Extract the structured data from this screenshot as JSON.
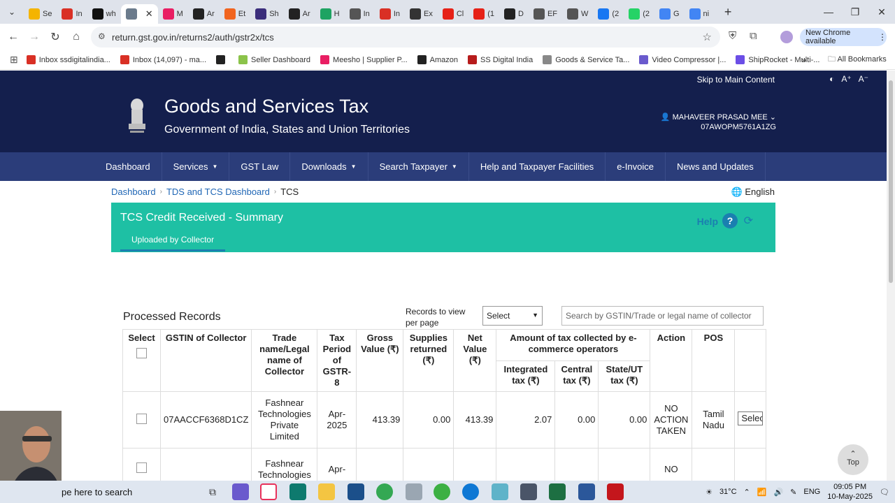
{
  "browser": {
    "tabs": [
      {
        "label": "Se",
        "color": "#f4b400"
      },
      {
        "label": "In",
        "color": "#d93025"
      },
      {
        "label": "wh",
        "color": "#111111"
      },
      {
        "label": "",
        "color": "#6b7b8c",
        "active": true
      },
      {
        "label": "M",
        "color": "#e91e63"
      },
      {
        "label": "Ar",
        "color": "#222222"
      },
      {
        "label": "Et",
        "color": "#f1641e"
      },
      {
        "label": "Sh",
        "color": "#3a2d7b"
      },
      {
        "label": "Ar",
        "color": "#222222"
      },
      {
        "label": "H",
        "color": "#1ea362"
      },
      {
        "label": "In",
        "color": "#555555"
      },
      {
        "label": "In",
        "color": "#d93025"
      },
      {
        "label": "Ex",
        "color": "#333333"
      },
      {
        "label": "Cl",
        "color": "#e62117"
      },
      {
        "label": "(1",
        "color": "#e62117"
      },
      {
        "label": "D",
        "color": "#222222"
      },
      {
        "label": "EF",
        "color": "#555555"
      },
      {
        "label": "W",
        "color": "#555555"
      },
      {
        "label": "(2",
        "color": "#1877f2"
      },
      {
        "label": "(2",
        "color": "#25d366"
      },
      {
        "label": "G",
        "color": "#4285f4"
      },
      {
        "label": "ni",
        "color": "#4285f4"
      }
    ],
    "url": "return.gst.gov.in/returns2/auth/gstr2x/tcs",
    "new_chrome_label": "New Chrome available",
    "bookmarks": [
      {
        "label": "Inbox ssdigitalindia...",
        "color": "#d93025"
      },
      {
        "label": "Inbox (14,097) - ma...",
        "color": "#d93025"
      },
      {
        "label": "",
        "color": "#222222"
      },
      {
        "label": "Seller Dashboard",
        "color": "#8bc34a"
      },
      {
        "label": "Meesho | Supplier P...",
        "color": "#e91e63"
      },
      {
        "label": "Amazon",
        "color": "#222222"
      },
      {
        "label": "SS Digital India",
        "color": "#b71c1c"
      },
      {
        "label": "Goods & Service Ta...",
        "color": "#888888"
      },
      {
        "label": "Video Compressor |...",
        "color": "#6a5acd"
      },
      {
        "label": "ShipRocket - Multi-...",
        "color": "#6b4ee6"
      }
    ],
    "all_bookmarks_label": "All Bookmarks"
  },
  "header": {
    "skip_link": "Skip to Main Content",
    "title": "Goods and Services Tax",
    "subtitle": "Government of India, States and Union Territories",
    "user_name": "MAHAVEER PRASAD MEE",
    "user_gstin": "07AWOPM5761A1ZG",
    "font_plus": "A⁺",
    "font_minus": "A⁻"
  },
  "nav": [
    {
      "label": "Dashboard",
      "caret": false
    },
    {
      "label": "Services",
      "caret": true
    },
    {
      "label": "GST Law",
      "caret": false
    },
    {
      "label": "Downloads",
      "caret": true
    },
    {
      "label": "Search Taxpayer",
      "caret": true
    },
    {
      "label": "Help and Taxpayer Facilities",
      "caret": false
    },
    {
      "label": "e-Invoice",
      "caret": false
    },
    {
      "label": "News and Updates",
      "caret": false
    }
  ],
  "breadcrumb": [
    "Dashboard",
    "TDS and TCS Dashboard",
    "TCS"
  ],
  "language": "English",
  "section": {
    "title": "TCS Credit Received - Summary",
    "tab": "Uploaded by Collector",
    "help": "Help"
  },
  "records": {
    "title": "Processed Records",
    "records_label": "Records to view per page",
    "select_value": "Select",
    "search_placeholder": "Search by GSTIN/Trade or legal name of collector",
    "headers": {
      "select": "Select",
      "gstin": "GSTIN of Collector",
      "trade": "Trade name/Legal name of Collector",
      "period": "Tax Period of GSTR-8",
      "gross": "Gross Value (₹)",
      "returned": "Supplies returned (₹)",
      "net": "Net Value (₹)",
      "amount": "Amount of tax collected by e-commerce operators",
      "igst": "Integrated tax (₹)",
      "cgst": "Central tax (₹)",
      "sgst": "State/UT tax (₹)",
      "action": "Action",
      "pos": "POS"
    },
    "rows": [
      {
        "gstin": "07AACCF6368D1CZ",
        "trade": "Fashnear Technologies Private Limited",
        "period": "Apr-2025",
        "gross": "413.39",
        "returned": "0.00",
        "net": "413.39",
        "igst": "2.07",
        "cgst": "0.00",
        "sgst": "0.00",
        "action": "NO ACTION TAKEN",
        "pos": "Tamil Nadu",
        "select": "Select"
      },
      {
        "gstin": "",
        "trade": "Fashnear Technologies",
        "period": "Apr-",
        "gross": "",
        "returned": "",
        "net": "",
        "igst": "",
        "cgst": "",
        "sgst": "",
        "action": "NO",
        "pos": "",
        "select": ""
      }
    ]
  },
  "top_button": "Top",
  "taskbar": {
    "search_text": "pe here to search",
    "temperature": "31°C",
    "language": "ENG",
    "time": "09:05 PM",
    "date": "10-May-2025"
  }
}
